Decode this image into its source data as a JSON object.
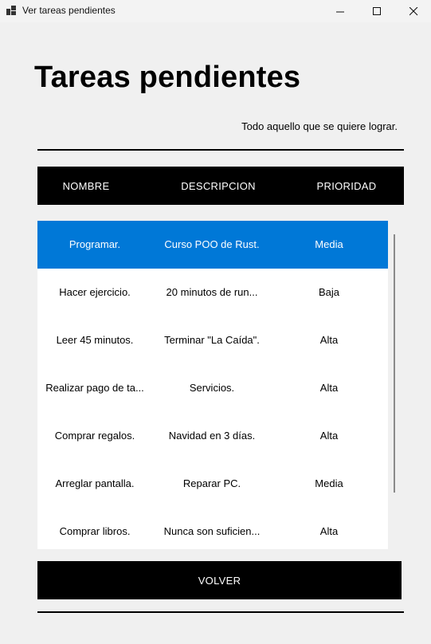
{
  "window": {
    "title": "Ver tareas pendientes",
    "icons": {
      "app": "app-icon",
      "minimize": "minimize-icon",
      "maximize": "maximize-icon",
      "close": "close-icon"
    }
  },
  "page": {
    "title": "Tareas pendientes",
    "subtitle": "Todo aquello que se quiere lograr."
  },
  "table": {
    "headers": [
      "NOMBRE",
      "DESCRIPCION",
      "PRIORIDAD"
    ],
    "rows": [
      {
        "nombre": "Programar.",
        "descripcion": "Curso POO de Rust.",
        "prioridad": "Media"
      },
      {
        "nombre": "Hacer ejercicio.",
        "descripcion": "20 minutos de run...",
        "prioridad": "Baja"
      },
      {
        "nombre": "Leer 45 minutos.",
        "descripcion": "Terminar \"La Caída\".",
        "prioridad": "Alta"
      },
      {
        "nombre": "Realizar pago de ta...",
        "descripcion": "Servicios.",
        "prioridad": "Alta"
      },
      {
        "nombre": "Comprar regalos.",
        "descripcion": "Navidad en 3 días.",
        "prioridad": "Alta"
      },
      {
        "nombre": "Arreglar pantalla.",
        "descripcion": "Reparar PC.",
        "prioridad": "Media"
      },
      {
        "nombre": "Comprar libros.",
        "descripcion": "Nunca son suficien...",
        "prioridad": "Alta"
      }
    ],
    "selected_index": 0
  },
  "actions": {
    "back_label": "VOLVER"
  },
  "colors": {
    "selection": "#0078d7",
    "header_bg": "#000000",
    "background": "#f0f0f0"
  }
}
